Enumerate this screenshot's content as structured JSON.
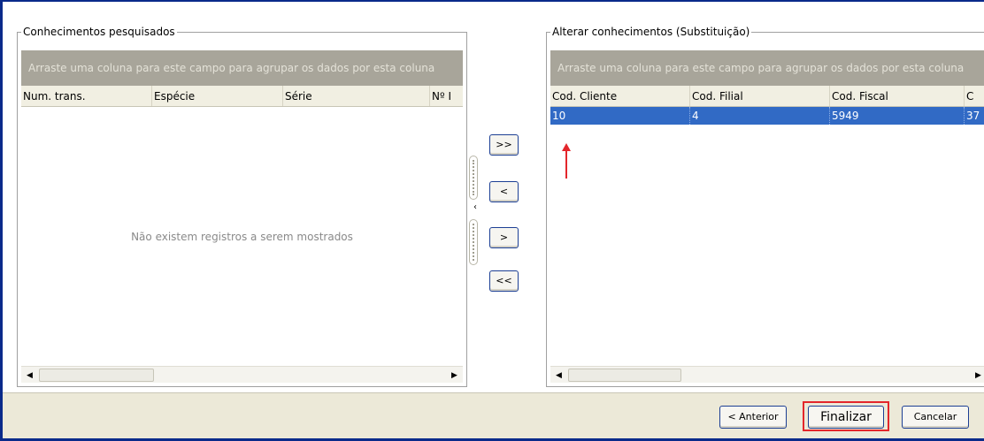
{
  "left_panel": {
    "legend": "Conhecimentos pesquisados",
    "group_hint": "Arraste uma coluna para este campo para agrupar os dados por esta coluna",
    "columns": [
      "Num. trans.",
      "Espécie",
      "Série",
      "Nº I"
    ],
    "empty_message": "Não existem registros a serem mostrados"
  },
  "right_panel": {
    "legend": "Alterar conhecimentos (Substituição)",
    "group_hint": "Arraste uma coluna para este campo para agrupar os dados por esta coluna",
    "columns": [
      "Cod. Cliente",
      "Cod. Filial",
      "Cod. Fiscal",
      "C"
    ],
    "rows": [
      [
        "10",
        "4",
        "5949",
        "37"
      ]
    ],
    "selected_row": 0
  },
  "move_buttons": {
    "add_all": ">>",
    "remove_one": "<",
    "add_one": ">",
    "remove_all": "<<"
  },
  "footer": {
    "previous": "< Anterior",
    "finish": "Finalizar",
    "cancel": "Cancelar"
  },
  "colors": {
    "selection": "#316ac5",
    "group_bar": "#a8a59a",
    "highlight": "#e3262b",
    "window_border": "#0a2a8a"
  },
  "icons": {
    "scroll_left": "arrow-left-icon",
    "scroll_right": "arrow-right-icon",
    "annotation": "red-arrow-icon"
  }
}
